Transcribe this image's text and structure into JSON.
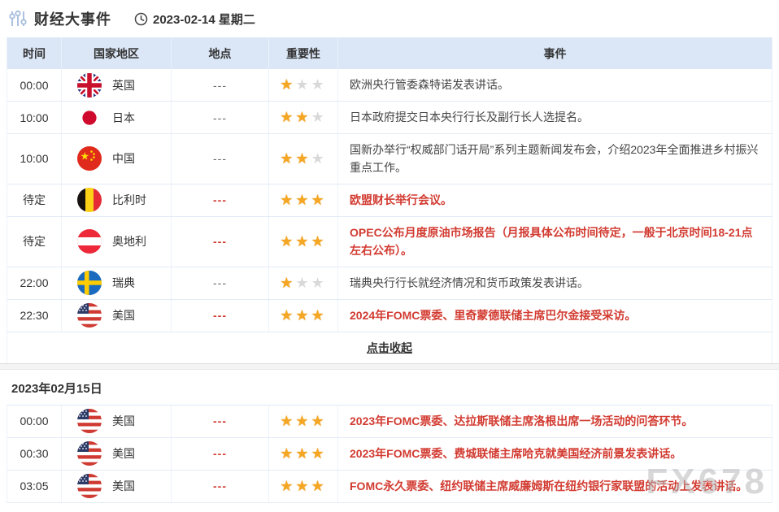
{
  "page": {
    "title": "财经大事件",
    "date_label": "2023-02-14 星期二",
    "collapse_label": "点击收起",
    "next_date_heading": "2023年02月15日",
    "watermark": "FX678"
  },
  "colors": {
    "header_bg": "#dbe7f7",
    "highlight_red": "#d23b31",
    "star_gold": "#f5a623",
    "star_gray": "#d9d9d9"
  },
  "table": {
    "headers": [
      "时间",
      "国家地区",
      "地点",
      "重要性",
      "事件"
    ]
  },
  "events_feb14": [
    {
      "time": "00:00",
      "country": "英国",
      "flag": "uk",
      "location": "---",
      "importance": 1,
      "max_importance": 3,
      "event": "欧洲央行管委森特诺发表讲话。",
      "highlight": false
    },
    {
      "time": "10:00",
      "country": "日本",
      "flag": "jp",
      "location": "---",
      "importance": 2,
      "max_importance": 3,
      "event": "日本政府提交日本央行行长及副行长人选提名。",
      "highlight": false
    },
    {
      "time": "10:00",
      "country": "中国",
      "flag": "cn",
      "location": "---",
      "importance": 2,
      "max_importance": 3,
      "event": "国新办举行“权威部门话开局”系列主题新闻发布会，介绍2023年全面推进乡村振兴重点工作。",
      "highlight": false
    },
    {
      "time": "待定",
      "country": "比利时",
      "flag": "be",
      "location": "---",
      "importance": 3,
      "max_importance": 3,
      "event": "欧盟财长举行会议。",
      "highlight": true
    },
    {
      "time": "待定",
      "country": "奥地利",
      "flag": "at",
      "location": "---",
      "importance": 3,
      "max_importance": 3,
      "event": "OPEC公布月度原油市场报告（月报具体公布时间待定，一般于北京时间18-21点左右公布）。",
      "highlight": true
    },
    {
      "time": "22:00",
      "country": "瑞典",
      "flag": "se",
      "location": "---",
      "importance": 1,
      "max_importance": 3,
      "event": "瑞典央行行长就经济情况和货币政策发表讲话。",
      "highlight": false
    },
    {
      "time": "22:30",
      "country": "美国",
      "flag": "us",
      "location": "---",
      "importance": 3,
      "max_importance": 3,
      "event": "2024年FOMC票委、里奇蒙德联储主席巴尔金接受采访。",
      "highlight": true
    }
  ],
  "events_feb15": [
    {
      "time": "00:00",
      "country": "美国",
      "flag": "us",
      "location": "---",
      "importance": 3,
      "max_importance": 3,
      "event": "2023年FOMC票委、达拉斯联储主席洛根出席一场活动的问答环节。",
      "highlight": true
    },
    {
      "time": "00:30",
      "country": "美国",
      "flag": "us",
      "location": "---",
      "importance": 3,
      "max_importance": 3,
      "event": "2023年FOMC票委、费城联储主席哈克就美国经济前景发表讲话。",
      "highlight": true
    },
    {
      "time": "03:05",
      "country": "美国",
      "flag": "us",
      "location": "---",
      "importance": 3,
      "max_importance": 3,
      "event": "FOMC永久票委、纽约联储主席威廉姆斯在纽约银行家联盟的活动上发表讲话。",
      "highlight": true
    }
  ]
}
